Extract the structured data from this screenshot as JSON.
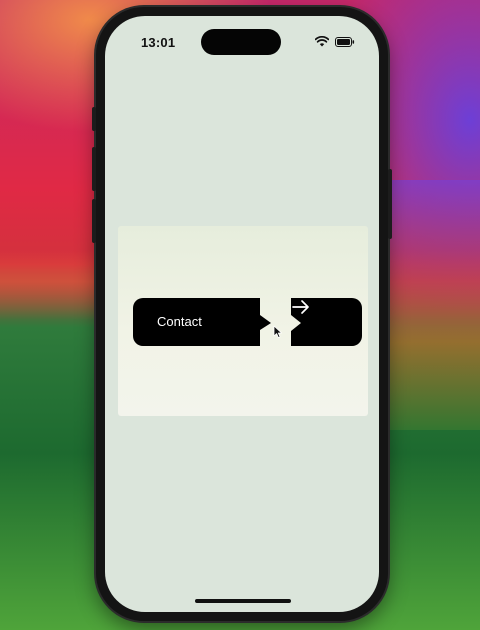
{
  "status_bar": {
    "time": "13:01",
    "icons": [
      "signal-icon",
      "wifi-icon",
      "battery-icon"
    ]
  },
  "preview": {
    "contact_button": {
      "label": "Contact"
    },
    "arrow_button": {
      "icon": "arrow-right-icon"
    }
  },
  "colors": {
    "screen_background": "#dbe5db",
    "button_fill": "#000000",
    "button_text": "#ffffff"
  }
}
